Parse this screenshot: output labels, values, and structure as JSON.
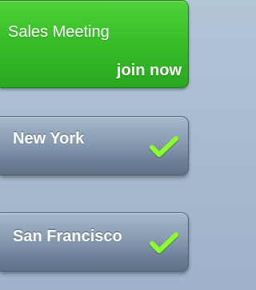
{
  "meeting": {
    "title": "Sales Meeting",
    "action_label": "join now"
  },
  "locations": [
    {
      "label": "New York",
      "selected": true,
      "icon": "checkmark-icon"
    },
    {
      "label": "San Francisco",
      "selected": true,
      "icon": "checkmark-icon"
    }
  ],
  "colors": {
    "meeting_green": "#39bf2a",
    "location_slate": "#7b90a6",
    "check_green": "#8aff2a"
  }
}
